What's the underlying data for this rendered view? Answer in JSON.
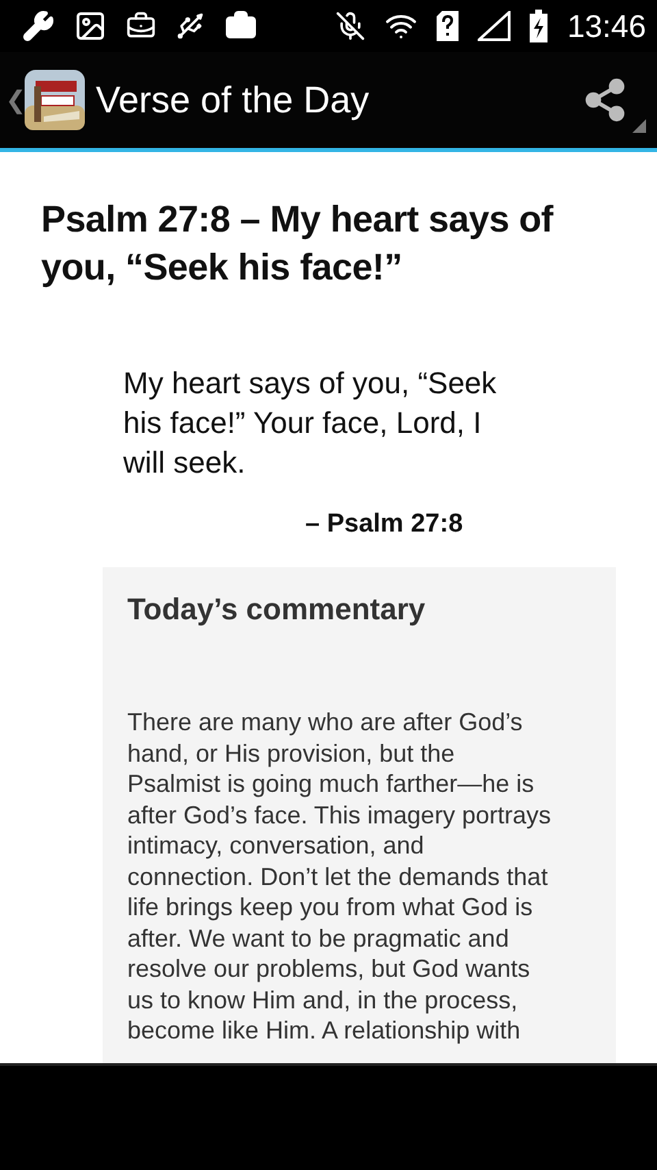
{
  "status_bar": {
    "time": "13:46"
  },
  "action_bar": {
    "back": "❮",
    "title": "Verse of the Day"
  },
  "verse": {
    "heading": "Psalm 27:8 – My heart says of you, “Seek his face!”",
    "text": "My heart says of you, “Seek his face!” Your face, Lord, I will seek.",
    "reference": "– Psalm 27:8"
  },
  "commentary": {
    "heading": "Today’s commentary",
    "lines": [
      "There are many who are after God’s",
      "hand, or His provision, but the",
      "Psalmist is going much farther—he is",
      "after God’s face. This imagery portrays",
      "intimacy, conversation, and",
      "connection. Don’t let the demands that",
      "life brings keep you from what God is",
      "after. We want to be pragmatic and",
      "resolve our problems, but God wants",
      "us to know Him and, in the process,",
      "become like Him. A relationship with"
    ]
  }
}
